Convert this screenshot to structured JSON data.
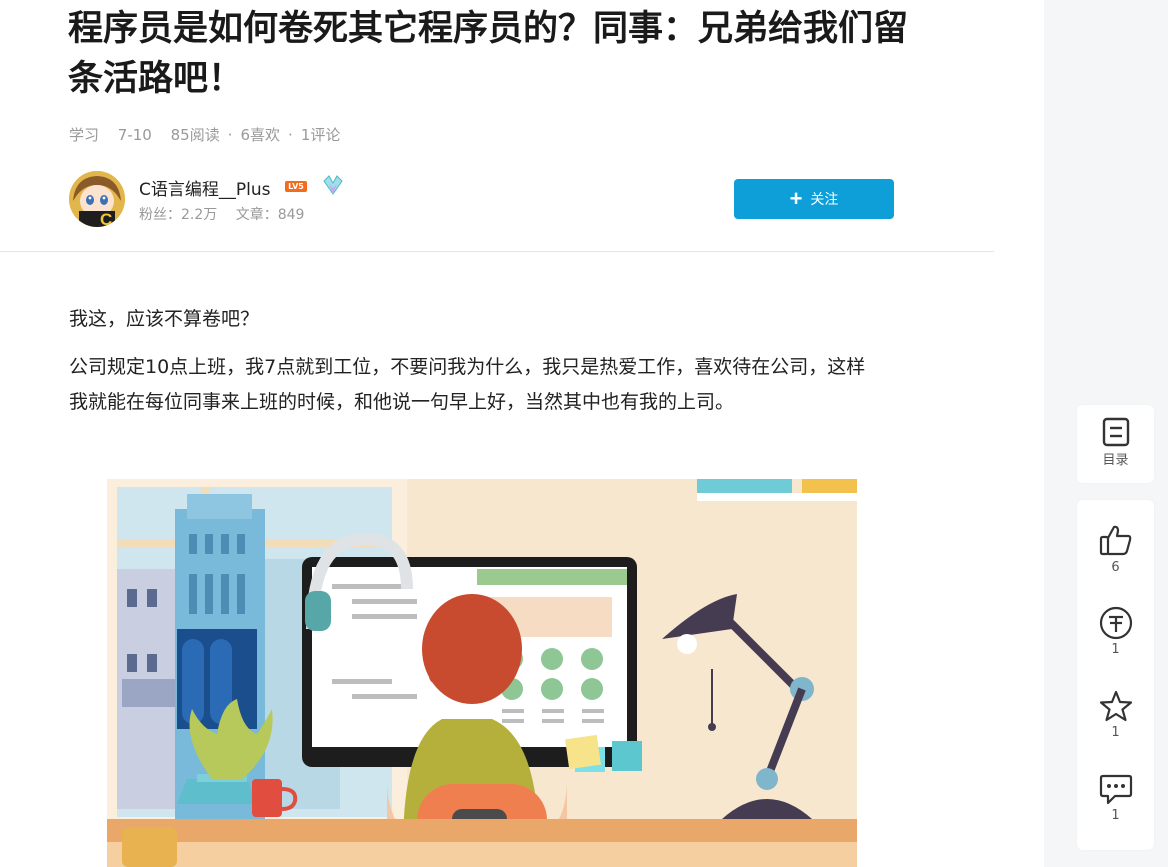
{
  "article": {
    "title": "程序员是如何卷死其它程序员的？同事：兄弟给我们留条活路吧！",
    "meta": {
      "category": "学习",
      "date": "7-10",
      "reads": "85阅读",
      "likes": "6喜欢",
      "comments": "1评论",
      "separator": "·"
    },
    "author": {
      "name": "C语言编程__Plus",
      "level_badge": "LV5",
      "fans": "粉丝：2.2万",
      "articles": "文章：849",
      "follow_label": "关注"
    },
    "paragraphs": [
      "我这，应该不算卷吧？",
      "公司规定10点上班，我7点就到工位，不要问我为什么，我只是热爱工作，喜欢待在公司，这样我就能在每位同事来上班的时候，和他说一句早上好，当然其中也有我的上司。"
    ]
  },
  "sidebar": {
    "toc_label": "目录",
    "like_count": "6",
    "reward_count": "1",
    "favorite_count": "1",
    "comment_count": "1"
  },
  "colors": {
    "accent": "#0e9fd9",
    "level_badge": "#f36b1c",
    "rail_bg": "#f5f6f7"
  }
}
